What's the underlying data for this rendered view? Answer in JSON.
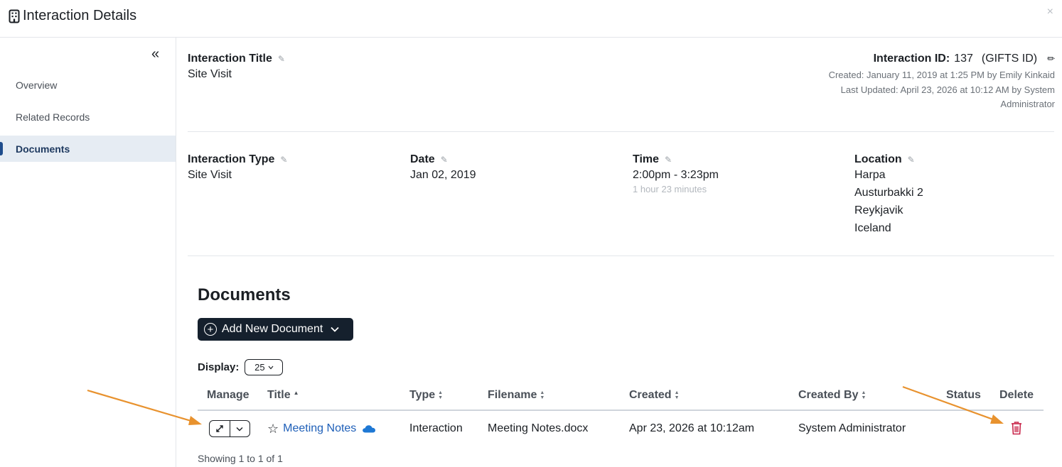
{
  "header": {
    "title": "Interaction Details",
    "title_icon": "building-icon",
    "close_glyph": "×"
  },
  "sidebar": {
    "collapse_glyph": "«",
    "items": [
      {
        "label": "Overview",
        "active": false
      },
      {
        "label": "Related Records",
        "active": false
      },
      {
        "label": "Documents",
        "active": true
      }
    ]
  },
  "details": {
    "title_label": "Interaction Title",
    "title_value": "Site Visit",
    "id_label": "Interaction ID:",
    "id_value": "137",
    "id_system": "(GIFTS ID)",
    "created": "Created: January 11, 2019 at 1:25 PM by Emily Kinkaid",
    "updated": "Last Updated: April 23, 2026 at 10:12 AM by System Administrator",
    "type_label": "Interaction Type",
    "type_value": "Site Visit",
    "date_label": "Date",
    "date_value": "Jan 02, 2019",
    "time_label": "Time",
    "time_value": "2:00pm - 3:23pm",
    "time_duration": "1 hour 23 minutes",
    "location_label": "Location",
    "location_lines": [
      "Harpa",
      "Austurbakki 2",
      "Reykjavik",
      "Iceland"
    ]
  },
  "documents": {
    "heading": "Documents",
    "add_button": "Add New Document",
    "display_label": "Display:",
    "display_value": "25",
    "columns": [
      "Manage",
      "Title",
      "Type",
      "Filename",
      "Created",
      "Created By",
      "Status",
      "Delete"
    ],
    "rows": [
      {
        "title": "Meeting Notes",
        "type": "Interaction",
        "filename": "Meeting Notes.docx",
        "created": "Apr 23, 2026 at 10:12am",
        "created_by": "System Administrator",
        "status": ""
      }
    ],
    "footer": "Showing 1 to 1 of 1"
  },
  "colors": {
    "link": "#1e5fb8",
    "button_dark": "#15202d",
    "delete": "#c8264a",
    "annotation_arrow": "#e8922e",
    "active_nav_bg": "#e6ecf3"
  }
}
